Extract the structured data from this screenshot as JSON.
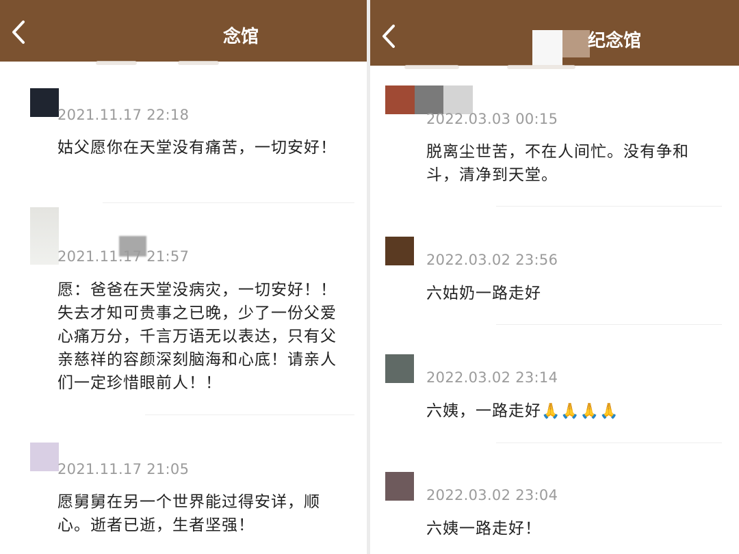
{
  "left_panel": {
    "header": {
      "title": "念馆",
      "back_icon": "chevron-left-icon"
    },
    "comments": [
      {
        "avatar_color": "#1f2530",
        "timestamp": "2021.11.17 22:18",
        "text": "姑父愿你在天堂没有痛苦，一切安好！"
      },
      {
        "avatar_color": "#ececea",
        "timestamp": "2021.11.17 21:57",
        "text": "愿：爸爸在天堂没病灾，一切安好！！ 失去才知可贵事之已晚，少了一份父爱心痛万分，千言万语无以表达，只有父亲慈祥的容颜深刻脑海和心底！请亲人们一定珍惜眼前人！！"
      },
      {
        "avatar_color": "#d9cfe4",
        "timestamp": "2021.11.17 21:05",
        "text": "愿舅舅在另一个世界能过得安详，顺心。逝者已逝，生者坚强！"
      }
    ]
  },
  "right_panel": {
    "header": {
      "title": "纪念馆",
      "back_icon": "chevron-left-icon"
    },
    "comments": [
      {
        "avatar_colors": [
          "#a04a34",
          "#7a7a7a",
          "#d4d4d4"
        ],
        "timestamp": "2022.03.03 00:15",
        "text": "脱离尘世苦，不在人间忙。没有争和斗，清净到天堂。"
      },
      {
        "avatar_color": "#5a3a22",
        "timestamp": "2022.03.02 23:56",
        "text": "六姑奶一路走好"
      },
      {
        "avatar_color": "#606a66",
        "timestamp": "2022.03.02 23:14",
        "text": "六姨，一路走好",
        "emoji": "🙏🙏🙏🙏"
      },
      {
        "avatar_color": "#6e5a5c",
        "timestamp": "2022.03.02 23:04",
        "text": "六姨一路走好！"
      }
    ]
  }
}
